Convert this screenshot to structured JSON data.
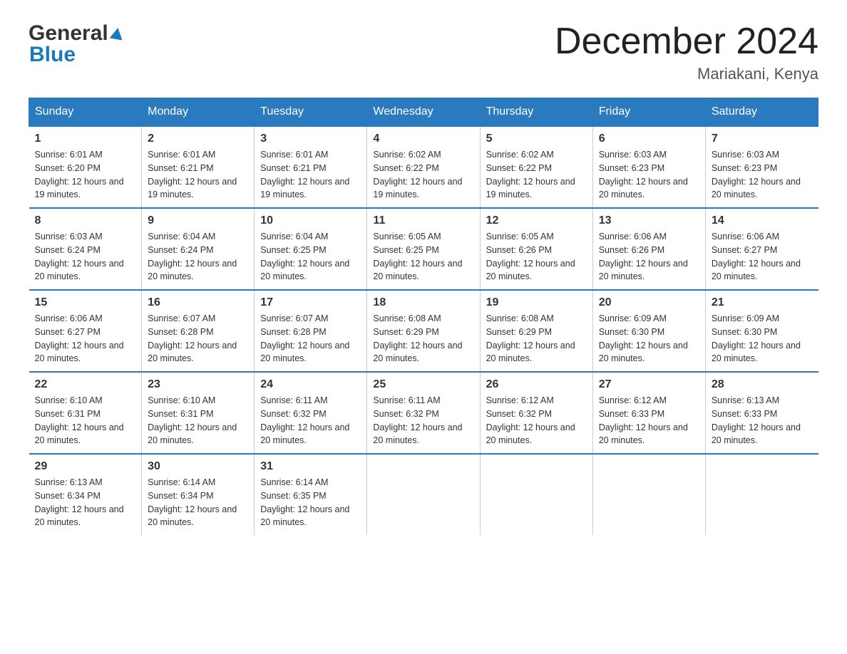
{
  "logo": {
    "general": "General",
    "blue": "Blue"
  },
  "title": "December 2024",
  "location": "Mariakani, Kenya",
  "days_of_week": [
    "Sunday",
    "Monday",
    "Tuesday",
    "Wednesday",
    "Thursday",
    "Friday",
    "Saturday"
  ],
  "weeks": [
    [
      {
        "day": "1",
        "sunrise": "6:01 AM",
        "sunset": "6:20 PM",
        "daylight": "12 hours and 19 minutes."
      },
      {
        "day": "2",
        "sunrise": "6:01 AM",
        "sunset": "6:21 PM",
        "daylight": "12 hours and 19 minutes."
      },
      {
        "day": "3",
        "sunrise": "6:01 AM",
        "sunset": "6:21 PM",
        "daylight": "12 hours and 19 minutes."
      },
      {
        "day": "4",
        "sunrise": "6:02 AM",
        "sunset": "6:22 PM",
        "daylight": "12 hours and 19 minutes."
      },
      {
        "day": "5",
        "sunrise": "6:02 AM",
        "sunset": "6:22 PM",
        "daylight": "12 hours and 19 minutes."
      },
      {
        "day": "6",
        "sunrise": "6:03 AM",
        "sunset": "6:23 PM",
        "daylight": "12 hours and 20 minutes."
      },
      {
        "day": "7",
        "sunrise": "6:03 AM",
        "sunset": "6:23 PM",
        "daylight": "12 hours and 20 minutes."
      }
    ],
    [
      {
        "day": "8",
        "sunrise": "6:03 AM",
        "sunset": "6:24 PM",
        "daylight": "12 hours and 20 minutes."
      },
      {
        "day": "9",
        "sunrise": "6:04 AM",
        "sunset": "6:24 PM",
        "daylight": "12 hours and 20 minutes."
      },
      {
        "day": "10",
        "sunrise": "6:04 AM",
        "sunset": "6:25 PM",
        "daylight": "12 hours and 20 minutes."
      },
      {
        "day": "11",
        "sunrise": "6:05 AM",
        "sunset": "6:25 PM",
        "daylight": "12 hours and 20 minutes."
      },
      {
        "day": "12",
        "sunrise": "6:05 AM",
        "sunset": "6:26 PM",
        "daylight": "12 hours and 20 minutes."
      },
      {
        "day": "13",
        "sunrise": "6:06 AM",
        "sunset": "6:26 PM",
        "daylight": "12 hours and 20 minutes."
      },
      {
        "day": "14",
        "sunrise": "6:06 AM",
        "sunset": "6:27 PM",
        "daylight": "12 hours and 20 minutes."
      }
    ],
    [
      {
        "day": "15",
        "sunrise": "6:06 AM",
        "sunset": "6:27 PM",
        "daylight": "12 hours and 20 minutes."
      },
      {
        "day": "16",
        "sunrise": "6:07 AM",
        "sunset": "6:28 PM",
        "daylight": "12 hours and 20 minutes."
      },
      {
        "day": "17",
        "sunrise": "6:07 AM",
        "sunset": "6:28 PM",
        "daylight": "12 hours and 20 minutes."
      },
      {
        "day": "18",
        "sunrise": "6:08 AM",
        "sunset": "6:29 PM",
        "daylight": "12 hours and 20 minutes."
      },
      {
        "day": "19",
        "sunrise": "6:08 AM",
        "sunset": "6:29 PM",
        "daylight": "12 hours and 20 minutes."
      },
      {
        "day": "20",
        "sunrise": "6:09 AM",
        "sunset": "6:30 PM",
        "daylight": "12 hours and 20 minutes."
      },
      {
        "day": "21",
        "sunrise": "6:09 AM",
        "sunset": "6:30 PM",
        "daylight": "12 hours and 20 minutes."
      }
    ],
    [
      {
        "day": "22",
        "sunrise": "6:10 AM",
        "sunset": "6:31 PM",
        "daylight": "12 hours and 20 minutes."
      },
      {
        "day": "23",
        "sunrise": "6:10 AM",
        "sunset": "6:31 PM",
        "daylight": "12 hours and 20 minutes."
      },
      {
        "day": "24",
        "sunrise": "6:11 AM",
        "sunset": "6:32 PM",
        "daylight": "12 hours and 20 minutes."
      },
      {
        "day": "25",
        "sunrise": "6:11 AM",
        "sunset": "6:32 PM",
        "daylight": "12 hours and 20 minutes."
      },
      {
        "day": "26",
        "sunrise": "6:12 AM",
        "sunset": "6:32 PM",
        "daylight": "12 hours and 20 minutes."
      },
      {
        "day": "27",
        "sunrise": "6:12 AM",
        "sunset": "6:33 PM",
        "daylight": "12 hours and 20 minutes."
      },
      {
        "day": "28",
        "sunrise": "6:13 AM",
        "sunset": "6:33 PM",
        "daylight": "12 hours and 20 minutes."
      }
    ],
    [
      {
        "day": "29",
        "sunrise": "6:13 AM",
        "sunset": "6:34 PM",
        "daylight": "12 hours and 20 minutes."
      },
      {
        "day": "30",
        "sunrise": "6:14 AM",
        "sunset": "6:34 PM",
        "daylight": "12 hours and 20 minutes."
      },
      {
        "day": "31",
        "sunrise": "6:14 AM",
        "sunset": "6:35 PM",
        "daylight": "12 hours and 20 minutes."
      },
      null,
      null,
      null,
      null
    ]
  ]
}
